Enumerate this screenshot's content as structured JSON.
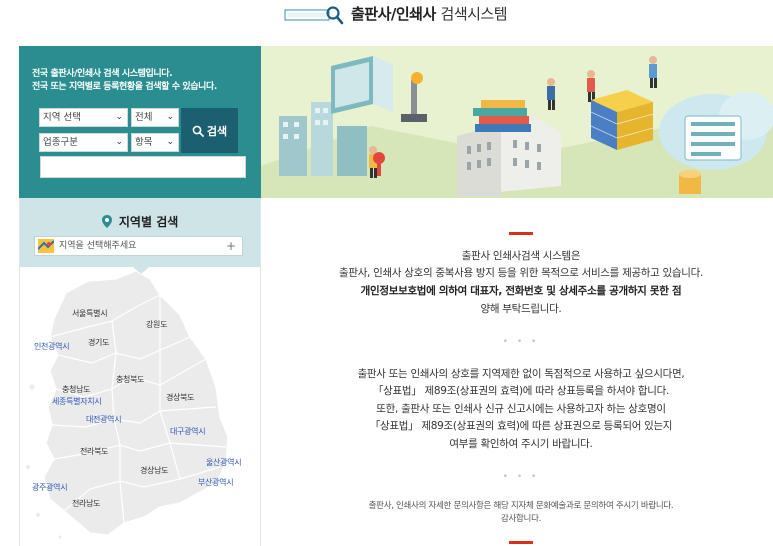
{
  "header": {
    "title_bold": "출판사/인쇄사",
    "title_rest": "검색시스템"
  },
  "search_panel": {
    "intro_line1": "전국 출판사/인쇄사 검색 시스템입니다.",
    "intro_line2": "전국 또는 지역별로 등록현황을 검색할 수 있습니다.",
    "region_select": "지역 선택",
    "scope_select": "전체",
    "business_type_select": "업종구분",
    "field_select": "항목",
    "search_button": "검색",
    "keyword_value": ""
  },
  "region_panel": {
    "title": "지역별 검색",
    "select_placeholder": "지역을 선택해주세요",
    "regions": {
      "seoul": "서울특별시",
      "gangwon": "강원도",
      "incheon": "인천광역시",
      "gyeonggi": "경기도",
      "chungbuk": "충청북도",
      "chungnam": "충청남도",
      "sejong": "세종특별자치시",
      "gyeongbuk": "경상북도",
      "daejeon": "대전광역시",
      "daegu": "대구광역시",
      "jeonbuk": "전라북도",
      "ulsan": "울산광역시",
      "gyeongnam": "경상남도",
      "busan": "부산광역시",
      "gwangju": "광주광역시",
      "jeonnam": "전라남도"
    }
  },
  "notice": {
    "para1_line1": "출판사 인쇄사검색 시스템은",
    "para1_line2": "출판사, 인쇄사 상호의 중복사용 방지 등을 위한 목적으로 서비스를 제공하고 있습니다.",
    "para1_line3": "개인정보보호법에 의하여 대표자, 전화번호 및 상세주소를 공개하지 못한 점",
    "para1_line4": "양해 부탁드립니다.",
    "para2_line1": "출판사 또는 인쇄사의 상호를 지역제한 없이 독점적으로 사용하고 싶으시다면,",
    "para2_line2": "「상표법」 제89조(상표권의 효력)에 따라 상표등록을 하셔야 합니다.",
    "para2_line3": "또한, 출판사 또는 인쇄사 신규 신고시에는 사용하고자 하는 상호명이",
    "para2_line4": "「상표법」 제89조(상표권의 효력)에 따른 상표권으로 등록되어 있는지",
    "para2_line5": "여부를 확인하여 주시기 바랍니다.",
    "para3_line1": "출판사, 인쇄사의 자세한 문의사항은 해당 지자체 문화예술과로 문의하여 주시기 바랍니다.",
    "para3_line2": "감사합니다.",
    "dots": "• • •"
  },
  "colors": {
    "panel_teal": "#2a8d8f",
    "button_dark": "#1c5f70",
    "region_head": "#cfe4e7",
    "accent_red": "#d5321d",
    "hero_bg": "#e9f2d2"
  }
}
